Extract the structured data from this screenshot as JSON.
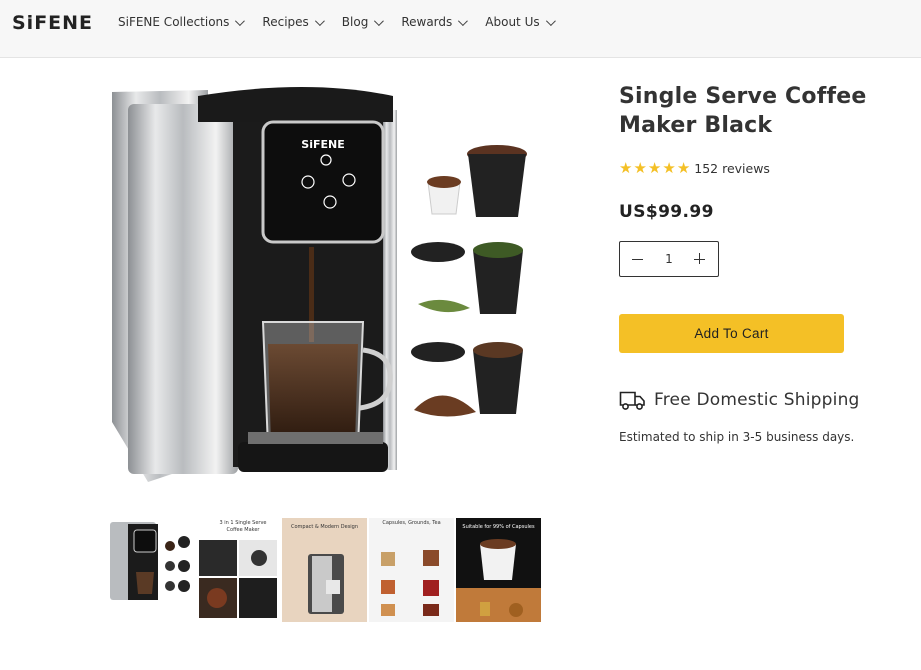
{
  "header": {
    "logo": "SiFENE",
    "nav": [
      {
        "label": "SiFENE Collections"
      },
      {
        "label": "Recipes"
      },
      {
        "label": "Blog"
      },
      {
        "label": "Rewards"
      },
      {
        "label": "About Us"
      }
    ]
  },
  "product": {
    "title": "Single Serve Coffee Maker Black",
    "rating": 5,
    "reviews_label": "152 reviews",
    "price": "US$99.99",
    "quantity": "1",
    "add_to_cart_label": "Add To Cart",
    "shipping_title": "Free Domestic Shipping",
    "shipping_note": "Estimated to ship in 3-5 business days.",
    "machine_brand": "SiFENE"
  },
  "thumbnails": [
    {
      "name": "machine-with-pods"
    },
    {
      "caption": "3 in 1 Single Serve Coffee Maker"
    },
    {
      "caption": "Compact & Modern Design"
    },
    {
      "caption": "Capsules, Grounds, Tea"
    },
    {
      "caption": "Suitable for 99% of Capsules"
    }
  ],
  "colors": {
    "accent": "#f4c026",
    "text": "#333333",
    "header_bg": "#f7f7f7"
  }
}
